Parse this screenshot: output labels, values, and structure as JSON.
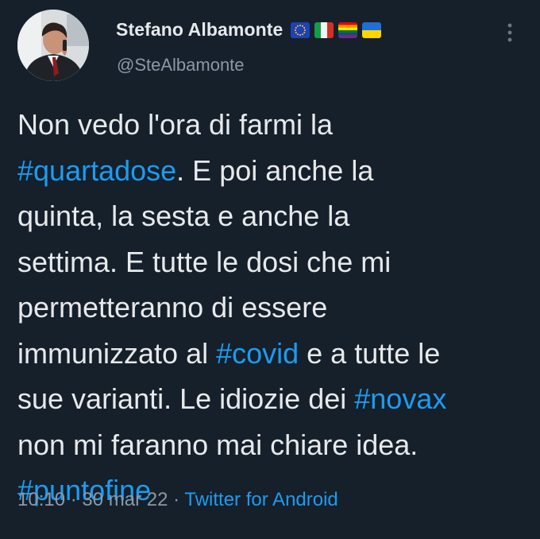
{
  "author": {
    "name": "Stefano Albamonte",
    "handle": "@SteAlbamonte",
    "flags": [
      "eu-flag-icon",
      "italy-flag-icon",
      "rainbow-flag-icon",
      "ukraine-flag-icon"
    ]
  },
  "tweet": {
    "lines": [
      [
        {
          "t": "Non vedo l'ora di farmi la"
        }
      ],
      [
        {
          "t": "#quartadose",
          "tag": true
        },
        {
          "t": ". E poi anche la"
        }
      ],
      [
        {
          "t": "quinta, la sesta e anche la"
        }
      ],
      [
        {
          "t": "settima. E tutte le dosi che mi"
        }
      ],
      [
        {
          "t": "permetteranno di essere"
        }
      ],
      [
        {
          "t": "immunizzato al "
        },
        {
          "t": "#covid",
          "tag": true
        },
        {
          "t": " e a tutte le"
        }
      ],
      [
        {
          "t": "sue varianti. Le idiozie dei "
        },
        {
          "t": "#novax",
          "tag": true
        }
      ],
      [
        {
          "t": "non mi faranno mai chiare idea."
        }
      ],
      [
        {
          "t": "#puntofine",
          "tag": true
        }
      ]
    ]
  },
  "meta": {
    "time": "10:10",
    "sep1": " · ",
    "date": "30 mar 22",
    "sep2": " · ",
    "source": "Twitter for Android"
  },
  "colors": {
    "background": "#15202b",
    "text": "#e7e9ea",
    "secondary": "#8b98a5",
    "link": "#1d9bf0"
  }
}
